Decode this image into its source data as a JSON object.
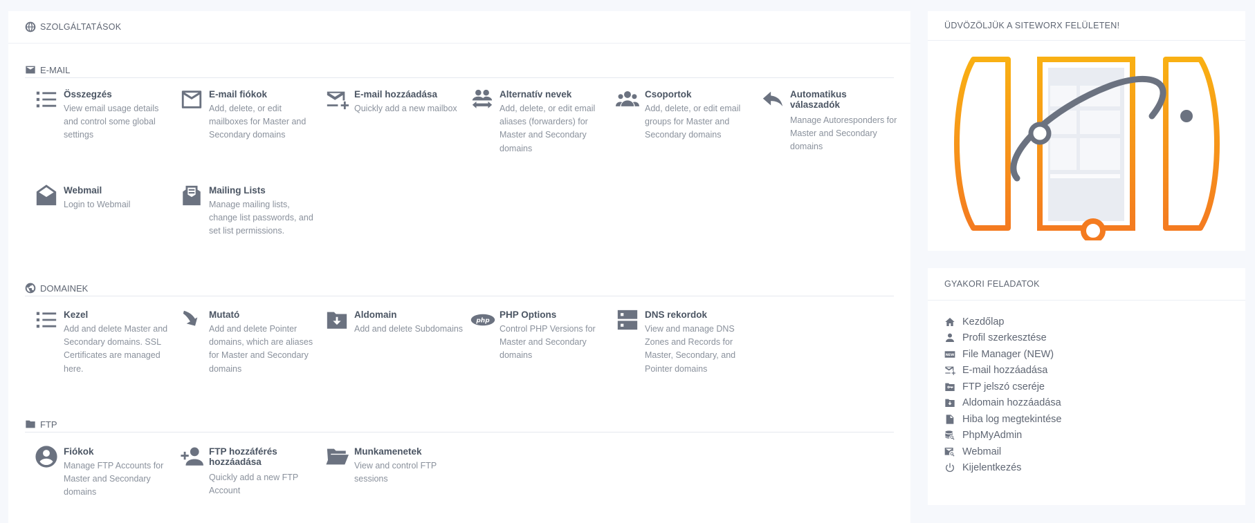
{
  "services": {
    "header": "SZOLGÁLTATÁSOK",
    "email": {
      "label": "E-MAIL",
      "items": [
        {
          "title": "Összegzés",
          "desc": "View email usage details and control some global settings",
          "icon": "list-icon"
        },
        {
          "title": "E-mail fiókok",
          "desc": "Add, delete, or edit mailboxes for Master and Secondary domains",
          "icon": "mailbox-icon"
        },
        {
          "title": "E-mail hozzáadása",
          "desc": "Quickly add a new mailbox",
          "icon": "mail-add-icon"
        },
        {
          "title": "Alternatív nevek",
          "desc": "Add, delete, or edit email aliases (forwarders) for Master and Secondary domains",
          "icon": "users-forward-icon"
        },
        {
          "title": "Csoportok",
          "desc": "Add, delete, or edit email groups for Master and Secondary domains",
          "icon": "group-icon"
        },
        {
          "title": "Automatikus válaszadók",
          "desc": "Manage Autoresponders for Master and Secondary domains",
          "icon": "reply-icon"
        },
        {
          "title": "Webmail",
          "desc": "Login to Webmail",
          "icon": "open-mail-icon"
        },
        {
          "title": "Mailing Lists",
          "desc": "Manage mailing lists, change list passwords, and set list permissions.",
          "icon": "mailing-list-icon"
        }
      ]
    },
    "domains": {
      "label": "DOMAINEK",
      "items": [
        {
          "title": "Kezel",
          "desc": "Add and delete Master and Secondary domains. SSL Certificates are managed here.",
          "icon": "list-icon"
        },
        {
          "title": "Mutató",
          "desc": "Add and delete Pointer domains, which are aliases for Master and Secondary domains",
          "icon": "pointer-arrow-icon"
        },
        {
          "title": "Aldomain",
          "desc": "Add and delete Subdomains",
          "icon": "folder-download-icon"
        },
        {
          "title": "PHP Options",
          "desc": "Control PHP Versions for Master and Secondary domains",
          "icon": "php-icon"
        },
        {
          "title": "DNS rekordok",
          "desc": "View and manage DNS Zones and Records for Master, Secondary, and Pointer domains",
          "icon": "server-icon"
        }
      ]
    },
    "ftp": {
      "label": "FTP",
      "items": [
        {
          "title": "Fiókok",
          "desc": "Manage FTP Accounts for Master and Secondary domains",
          "icon": "account-circle-icon"
        },
        {
          "title": "FTP hozzáférés hozzáadása",
          "desc": "Quickly add a new FTP Account",
          "icon": "person-add-icon"
        },
        {
          "title": "Munkamenetek",
          "desc": "View and control FTP sessions",
          "icon": "folder-open-icon"
        }
      ]
    }
  },
  "welcome": {
    "title": "ÜDVÖZÖLJÜK A SITEWORX FELÜLETEN!"
  },
  "tasks": {
    "title": "GYAKORI FELADATOK",
    "items": [
      {
        "label": "Kezdőlap",
        "icon": "home-icon"
      },
      {
        "label": "Profil szerkesztése",
        "icon": "person-icon"
      },
      {
        "label": "File Manager (NEW)",
        "icon": "new-badge-icon"
      },
      {
        "label": "E-mail hozzáadása",
        "icon": "mail-add-icon"
      },
      {
        "label": "FTP jelszó cseréje",
        "icon": "folder-key-icon"
      },
      {
        "label": "Aldomain hozzáadása",
        "icon": "folder-download-icon"
      },
      {
        "label": "Hiba log megtekintése",
        "icon": "document-icon"
      },
      {
        "label": "PhpMyAdmin",
        "icon": "database-search-icon"
      },
      {
        "label": "Webmail",
        "icon": "mail-search-icon"
      },
      {
        "label": "Kijelentkezés",
        "icon": "power-icon"
      }
    ]
  },
  "colors": {
    "accent_orange": "#f7a81b",
    "accent_dark": "#f47b20",
    "icon_gray": "#6b7280"
  }
}
